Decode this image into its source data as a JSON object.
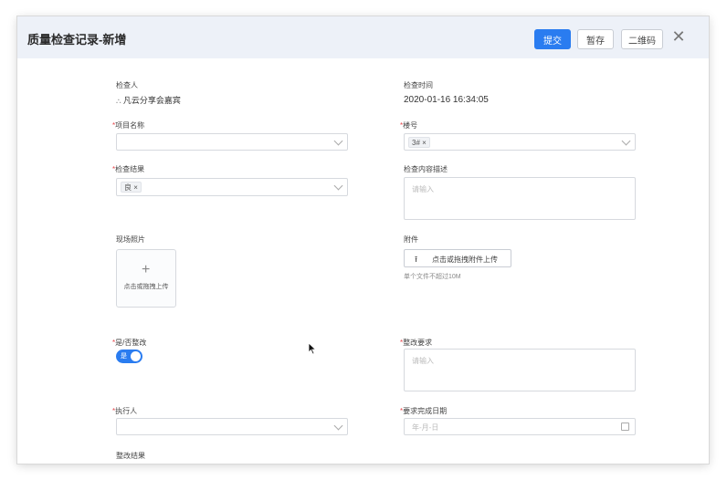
{
  "header": {
    "title": "质量检查记录-新增",
    "submit_label": "提交",
    "save_label": "暂存",
    "qrcode_label": "二维码",
    "close_glyph": "✕"
  },
  "form": {
    "inspector": {
      "label": "检查人",
      "value": "凡云分享会嘉宾"
    },
    "inspect_time": {
      "label": "检查时间",
      "value": "2020-01-16 16:34:05"
    },
    "project_name": {
      "label": "项目名称",
      "required": true,
      "value": ""
    },
    "building": {
      "label": "楼号",
      "required": true,
      "tags": [
        "3#"
      ]
    },
    "inspect_result": {
      "label": "检查结果",
      "required": true,
      "tags": [
        "良"
      ]
    },
    "inspect_desc": {
      "label": "检查内容描述",
      "placeholder": "请输入"
    },
    "site_photos": {
      "label": "现场照片",
      "upload_text": "点击或拖拽上传"
    },
    "attachment": {
      "label": "附件",
      "button_text": "点击或拖拽附件上传",
      "hint": "单个文件不超过10M"
    },
    "need_rectify": {
      "label": "是/否整改",
      "required": true,
      "toggle_text": "是",
      "on": true
    },
    "rectify_require": {
      "label": "整改要求",
      "required": true,
      "placeholder": "请输入"
    },
    "executor": {
      "label": "执行人",
      "required": true,
      "value": ""
    },
    "deadline": {
      "label": "要求完成日期",
      "required": true,
      "placeholder": "年-月-日"
    },
    "rectify_result": {
      "label": "整改结果"
    }
  },
  "colors": {
    "accent": "#2a7cf0",
    "header_bg": "#edf1f8",
    "required": "#e5484d"
  }
}
